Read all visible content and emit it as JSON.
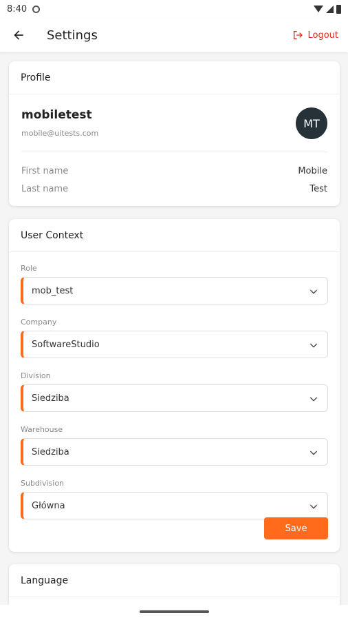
{
  "status": {
    "time": "8:40"
  },
  "header": {
    "title": "Settings",
    "logout_label": "Logout"
  },
  "profile": {
    "section_title": "Profile",
    "username": "mobiletest",
    "email": "mobile@uitests.com",
    "initials": "MT",
    "rows": [
      {
        "label": "First name",
        "value": "Mobile"
      },
      {
        "label": "Last name",
        "value": "Test"
      }
    ]
  },
  "context": {
    "section_title": "User Context",
    "fields": [
      {
        "label": "Role",
        "value": "mob_test"
      },
      {
        "label": "Company",
        "value": "SoftwareStudio"
      },
      {
        "label": "Division",
        "value": "Siedziba"
      },
      {
        "label": "Warehouse",
        "value": "Siedziba"
      },
      {
        "label": "Subdivision",
        "value": "Główna"
      }
    ],
    "save_label": "Save"
  },
  "language": {
    "section_title": "Language"
  },
  "colors": {
    "accent": "#ff6b1a",
    "logout": "#e02a1c",
    "avatar_bg": "#263238"
  }
}
